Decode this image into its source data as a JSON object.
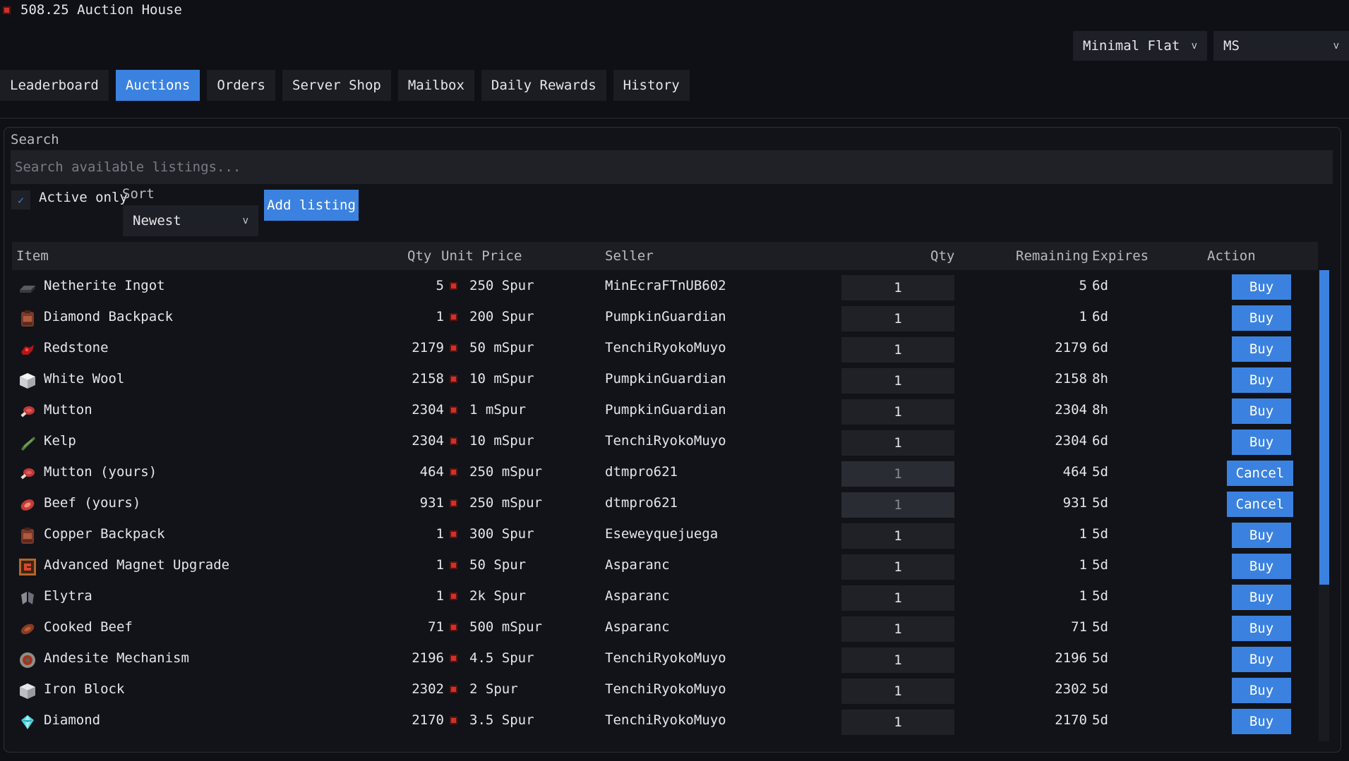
{
  "topbar": {
    "balance": "508.25",
    "title": "Auction House",
    "coin_color": "#d2302b"
  },
  "controls": {
    "theme": "Minimal Flat",
    "font": "MS"
  },
  "tabs": [
    {
      "label": "Leaderboard",
      "active": false
    },
    {
      "label": "Auctions",
      "active": true
    },
    {
      "label": "Orders",
      "active": false
    },
    {
      "label": "Server Shop",
      "active": false
    },
    {
      "label": "Mailbox",
      "active": false
    },
    {
      "label": "Daily Rewards",
      "active": false
    },
    {
      "label": "History",
      "active": false
    }
  ],
  "search": {
    "label": "Search",
    "placeholder": "Search available listings..."
  },
  "filters": {
    "active_only_label": "Active only",
    "active_only_checked": true,
    "sort_label": "Sort",
    "sort_value": "Newest",
    "add_listing_label": "Add listing"
  },
  "table": {
    "headers": {
      "item": "Item",
      "qty": "Qty",
      "unit_price": "Unit Price",
      "seller": "Seller",
      "buy_qty": "Qty",
      "remaining": "Remaining",
      "expires": "Expires",
      "action": "Action"
    },
    "rows": [
      {
        "icon": "netherite-ingot-icon",
        "item": "Netherite Ingot",
        "qty": "5",
        "price": "250 Spur",
        "seller": "MinEcraFTnUB602",
        "buy_qty": "1",
        "remaining": "5",
        "expires": "6d",
        "action": "Buy"
      },
      {
        "icon": "backpack-icon",
        "item": "Diamond Backpack",
        "qty": "1",
        "price": "200 Spur",
        "seller": "PumpkinGuardian",
        "buy_qty": "1",
        "remaining": "1",
        "expires": "6d",
        "action": "Buy"
      },
      {
        "icon": "redstone-icon",
        "item": "Redstone",
        "qty": "2179",
        "price": "50 mSpur",
        "seller": "TenchiRyokoMuyo",
        "buy_qty": "1",
        "remaining": "2179",
        "expires": "6d",
        "action": "Buy"
      },
      {
        "icon": "white-wool-icon",
        "item": "White Wool",
        "qty": "2158",
        "price": "10 mSpur",
        "seller": "PumpkinGuardian",
        "buy_qty": "1",
        "remaining": "2158",
        "expires": "8h",
        "action": "Buy"
      },
      {
        "icon": "mutton-icon",
        "item": "Mutton",
        "qty": "2304",
        "price": "1 mSpur",
        "seller": "PumpkinGuardian",
        "buy_qty": "1",
        "remaining": "2304",
        "expires": "8h",
        "action": "Buy"
      },
      {
        "icon": "kelp-icon",
        "item": "Kelp",
        "qty": "2304",
        "price": "10 mSpur",
        "seller": "TenchiRyokoMuyo",
        "buy_qty": "1",
        "remaining": "2304",
        "expires": "6d",
        "action": "Buy"
      },
      {
        "icon": "mutton-icon",
        "item": "Mutton (yours)",
        "qty": "464",
        "price": "250 mSpur",
        "seller": "dtmpro621",
        "buy_qty": "1",
        "remaining": "464",
        "expires": "5d",
        "action": "Cancel"
      },
      {
        "icon": "beef-icon",
        "item": "Beef (yours)",
        "qty": "931",
        "price": "250 mSpur",
        "seller": "dtmpro621",
        "buy_qty": "1",
        "remaining": "931",
        "expires": "5d",
        "action": "Cancel"
      },
      {
        "icon": "backpack-icon",
        "item": "Copper Backpack",
        "qty": "1",
        "price": "300 Spur",
        "seller": "Eseweyquejuega",
        "buy_qty": "1",
        "remaining": "1",
        "expires": "5d",
        "action": "Buy"
      },
      {
        "icon": "magnet-upgrade-icon",
        "item": "Advanced Magnet Upgrade",
        "qty": "1",
        "price": "50 Spur",
        "seller": "Asparanc",
        "buy_qty": "1",
        "remaining": "1",
        "expires": "5d",
        "action": "Buy"
      },
      {
        "icon": "elytra-icon",
        "item": "Elytra",
        "qty": "1",
        "price": "2k Spur",
        "seller": "Asparanc",
        "buy_qty": "1",
        "remaining": "1",
        "expires": "5d",
        "action": "Buy"
      },
      {
        "icon": "cooked-beef-icon",
        "item": "Cooked Beef",
        "qty": "71",
        "price": "500 mSpur",
        "seller": "Asparanc",
        "buy_qty": "1",
        "remaining": "71",
        "expires": "5d",
        "action": "Buy"
      },
      {
        "icon": "andesite-mechanism-icon",
        "item": "Andesite Mechanism",
        "qty": "2196",
        "price": "4.5 Spur",
        "seller": "TenchiRyokoMuyo",
        "buy_qty": "1",
        "remaining": "2196",
        "expires": "5d",
        "action": "Buy"
      },
      {
        "icon": "iron-block-icon",
        "item": "Iron Block",
        "qty": "2302",
        "price": "2 Spur",
        "seller": "TenchiRyokoMuyo",
        "buy_qty": "1",
        "remaining": "2302",
        "expires": "5d",
        "action": "Buy"
      },
      {
        "icon": "diamond-icon",
        "item": "Diamond",
        "qty": "2170",
        "price": "3.5 Spur",
        "seller": "TenchiRyokoMuyo",
        "buy_qty": "1",
        "remaining": "2170",
        "expires": "5d",
        "action": "Buy"
      }
    ]
  },
  "colors": {
    "accent": "#3b82e0",
    "background": "#0f1015",
    "panel": "#1e2027"
  }
}
